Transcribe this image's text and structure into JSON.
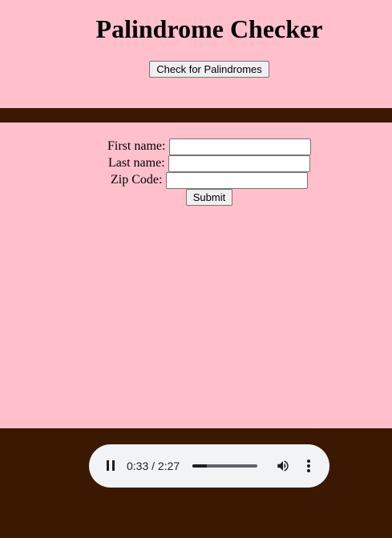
{
  "header": {
    "title": "Palindrome Checker",
    "check_button_label": "Check for Palindromes"
  },
  "form": {
    "first_name_label": "First name:",
    "first_name_value": "",
    "last_name_label": "Last name:",
    "last_name_value": "",
    "zip_label": "Zip Code:",
    "zip_value": "",
    "submit_label": "Submit"
  },
  "audio_player": {
    "state": "playing",
    "time_display": "0:33 / 2:27",
    "progress": 0.224,
    "icons": [
      "pause-icon",
      "volume-icon",
      "more-options-icon"
    ]
  },
  "colors": {
    "page_background": "#ffc0cb",
    "stripe_color": "#3b1800",
    "player_background": "#f1f3f4"
  }
}
